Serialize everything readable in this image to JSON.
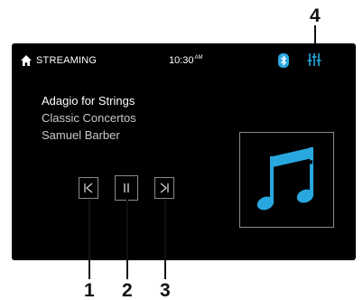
{
  "status_bar": {
    "source": "STREAMING",
    "time": "10:30",
    "ampm": "AM"
  },
  "track": {
    "title": "Adagio for Strings",
    "album": "Classic Concertos",
    "artist": "Samuel Barber"
  },
  "callouts": {
    "prev": "1",
    "play_pause": "2",
    "next": "3",
    "settings": "4"
  },
  "icons": {
    "home": "home-icon",
    "bluetooth": "bluetooth-icon",
    "settings": "equalizer-icon",
    "prev": "skip-previous-icon",
    "pause": "pause-icon",
    "next": "skip-next-icon",
    "album_art": "music-note-icon"
  },
  "colors": {
    "screen_bg": "#000000",
    "accent": "#29a8e0",
    "text": "#ffffff",
    "callout": "#111111"
  }
}
